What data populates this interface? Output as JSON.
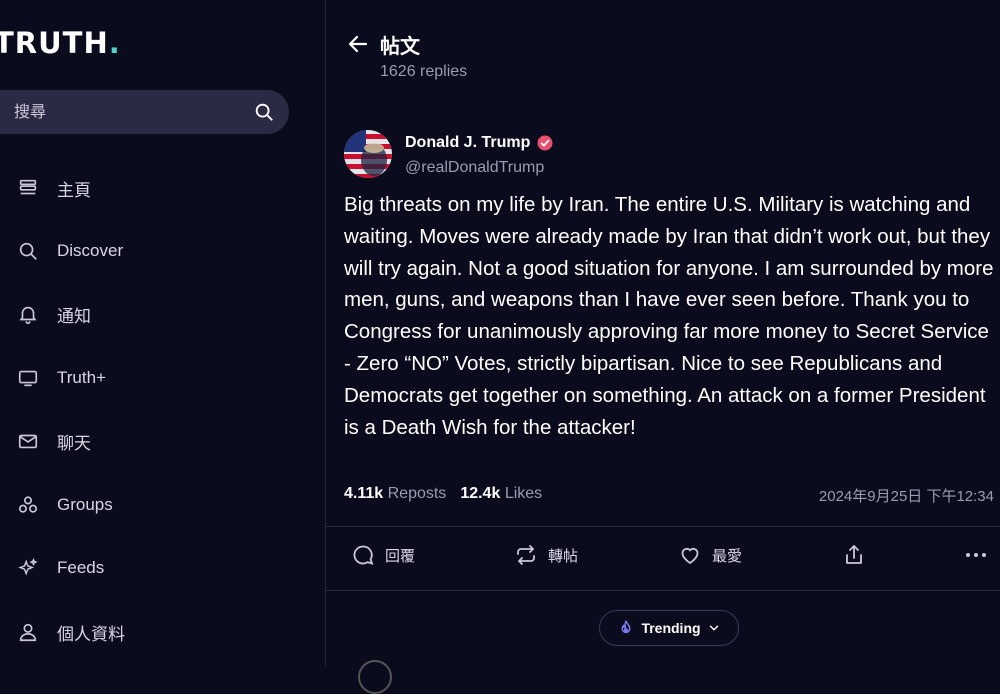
{
  "app": {
    "logo_text": "TRUTH",
    "logo_dot": "."
  },
  "search": {
    "placeholder": "搜尋"
  },
  "nav": [
    {
      "id": "home",
      "label": "主頁",
      "icon": "home-stack-icon"
    },
    {
      "id": "discover",
      "label": "Discover",
      "icon": "search-icon"
    },
    {
      "id": "notifications",
      "label": "通知",
      "icon": "bell-icon"
    },
    {
      "id": "truthplus",
      "label": "Truth+",
      "icon": "tv-icon"
    },
    {
      "id": "chat",
      "label": "聊天",
      "icon": "mail-icon"
    },
    {
      "id": "groups",
      "label": "Groups",
      "icon": "groups-icon"
    },
    {
      "id": "feeds",
      "label": "Feeds",
      "icon": "sparkles-icon"
    },
    {
      "id": "profile",
      "label": "個人資料",
      "icon": "user-icon"
    }
  ],
  "header": {
    "title": "帖文",
    "replies": "1626 replies"
  },
  "post": {
    "author_name": "Donald J. Trump",
    "handle": "@realDonaldTrump",
    "verified": true,
    "text": "Big threats on my life by Iran. The entire U.S. Military is watching and waiting. Moves were already made by Iran that didn’t work out, but they will try again. Not a good situation for anyone. I am surrounded by more men, guns, and weapons than I have ever seen before. Thank you to Congress for unanimously approving far more money to Secret Service - Zero “NO” Votes, strictly bipartisan. Nice to see Republicans and Democrats get together on something. An attack on a former President is a Death Wish for the attacker!",
    "reposts_count": "4.11k",
    "reposts_label": "Reposts",
    "likes_count": "12.4k",
    "likes_label": "Likes",
    "timestamp": "2024年9月25日 下午12:34"
  },
  "actions": {
    "reply": "回覆",
    "repost": "轉帖",
    "like": "最愛"
  },
  "trending": {
    "label": "Trending"
  },
  "colors": {
    "background": "#0b0b1e",
    "accent": "#4fd1c5",
    "verified": "#e8506e",
    "muted": "#9c9cb0"
  }
}
